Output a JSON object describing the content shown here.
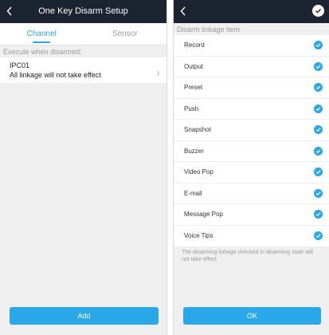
{
  "theme": {
    "header_bg": "#1b2430",
    "accent": "#2aa7e8",
    "background": "#efefef"
  },
  "left": {
    "header": {
      "title": "One Key Disarm Setup",
      "back_icon": "chevron-left-icon"
    },
    "tabs": [
      {
        "label": "Channel",
        "active": true
      },
      {
        "label": "Sensor",
        "active": false
      }
    ],
    "section_label": "Execute when disarmed:",
    "channel_item": {
      "name": "IPC01",
      "description": "All linkage will not take effect"
    },
    "add_button": "Add"
  },
  "right": {
    "header": {
      "back_icon": "chevron-left-icon",
      "done_icon": "check-circle-icon"
    },
    "section_label": "Disarm linkage item",
    "items": [
      {
        "label": "Record",
        "checked": true
      },
      {
        "label": "Output",
        "checked": true
      },
      {
        "label": "Preset",
        "checked": true
      },
      {
        "label": "Push",
        "checked": true
      },
      {
        "label": "Snapshot",
        "checked": true
      },
      {
        "label": "Buzzer",
        "checked": true
      },
      {
        "label": "Video Pop",
        "checked": true
      },
      {
        "label": "E-mail",
        "checked": true
      },
      {
        "label": "Message Pop",
        "checked": true
      },
      {
        "label": "Voice Tips",
        "checked": true
      }
    ],
    "footnote": "The disarming linkage checked in disarming state will not take effect",
    "ok_button": "OK"
  }
}
